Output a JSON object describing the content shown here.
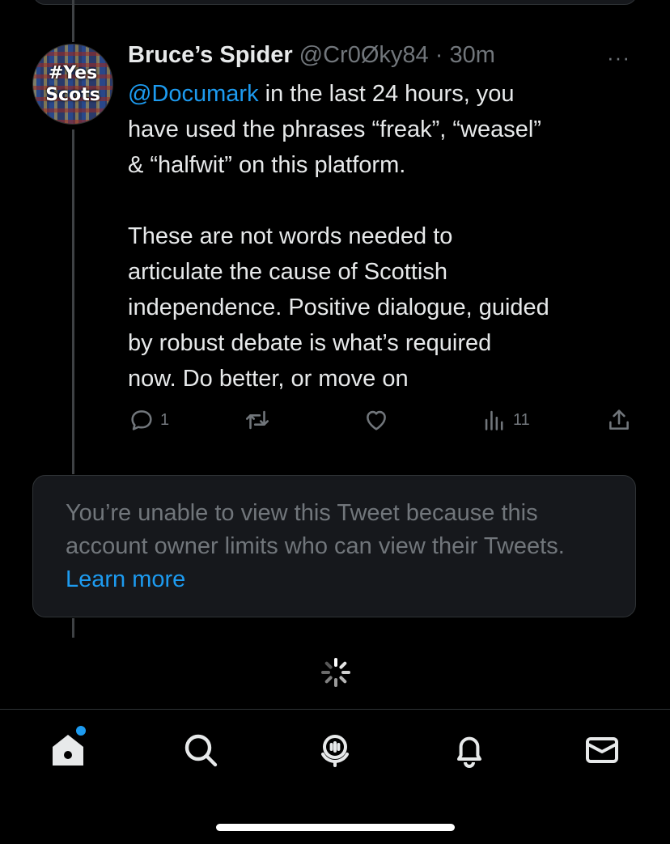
{
  "tweet": {
    "avatar_text": [
      "#Yes",
      "Scots"
    ],
    "display_name": "Bruce’s Spider",
    "handle": "@Cr0Øky84",
    "separator": " · ",
    "time": "30m",
    "more_label": "···",
    "mention": "@Documark",
    "body": " in the last 24 hours, you\nhave used the phrases “freak”, “weasel”\n& “halfwit” on this platform.\n\nThese are not words needed to\narticulate the cause of Scottish\nindependence. Positive dialogue, guided\nby robust debate is what’s required\nnow. Do better, or move on",
    "reply_count": "1",
    "views_count": "11",
    "icons": [
      "reply-icon",
      "retweet-icon",
      "like-icon",
      "views-icon",
      "share-icon",
      "more-icon"
    ]
  },
  "unavailable": {
    "text": "You’re unable to view this Tweet because this account owner limits who can view their Tweets. ",
    "link": "Learn more"
  },
  "tabbar": {
    "icons": [
      "home-icon",
      "search-icon",
      "spaces-icon",
      "notifications-icon",
      "messages-icon"
    ],
    "notification_dot_color": "#1d9bf0"
  },
  "colors": {
    "accent": "#1d9bf0",
    "muted": "#71767b",
    "text": "#e7e9ea",
    "background": "#000000"
  }
}
